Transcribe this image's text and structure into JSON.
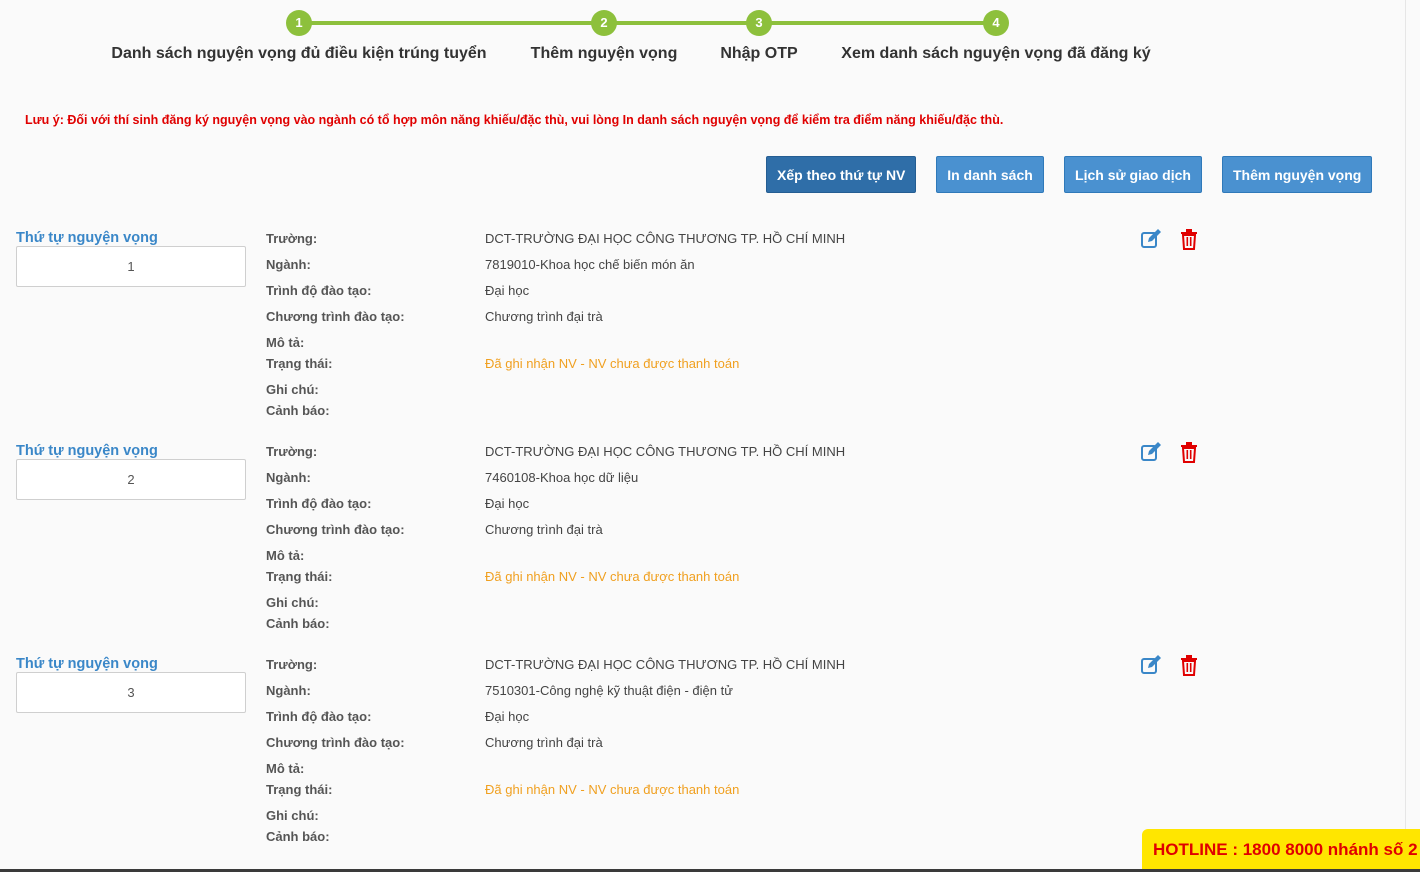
{
  "stepper": {
    "steps": [
      {
        "number": "1",
        "label": "Danh sách nguyện vọng đủ điều kiện trúng tuyển"
      },
      {
        "number": "2",
        "label": "Thêm nguyện vọng"
      },
      {
        "number": "3",
        "label": "Nhập OTP"
      },
      {
        "number": "4",
        "label": "Xem danh sách nguyện vọng đã đăng ký"
      }
    ]
  },
  "notice": "Lưu ý: Đối với thí sinh đăng ký nguyện vọng vào ngành có tổ hợp môn năng khiếu/đặc thù, vui lòng In danh sách nguyện vọng để kiểm tra điểm năng khiếu/đặc thù.",
  "actions": {
    "sort": "Xếp theo thứ tự NV",
    "print": "In danh sách",
    "history": "Lịch sử giao dịch",
    "add": "Thêm nguyện vọng"
  },
  "field_labels": {
    "order": "Thứ tự nguyện vọng",
    "school": "Trường:",
    "major": "Ngành:",
    "level": "Trình độ đào tạo:",
    "program": "Chương trình đào tạo:",
    "description": "Mô tả:",
    "status": "Trạng thái:",
    "note": "Ghi chú:",
    "warning": "Cảnh báo:"
  },
  "wishes": [
    {
      "order": "1",
      "school": "DCT-TRƯỜNG ĐẠI HỌC CÔNG THƯƠNG TP. HỒ CHÍ MINH",
      "major": "7819010-Khoa học chế biến món ăn",
      "level": "Đại học",
      "program": "Chương trình đại trà",
      "description": "",
      "status": "Đã ghi nhận NV - NV chưa được thanh toán",
      "note": "",
      "warning": ""
    },
    {
      "order": "2",
      "school": "DCT-TRƯỜNG ĐẠI HỌC CÔNG THƯƠNG TP. HỒ CHÍ MINH",
      "major": "7460108-Khoa học dữ liệu",
      "level": "Đại học",
      "program": "Chương trình đại trà",
      "description": "",
      "status": "Đã ghi nhận NV - NV chưa được thanh toán",
      "note": "",
      "warning": ""
    },
    {
      "order": "3",
      "school": "DCT-TRƯỜNG ĐẠI HỌC CÔNG THƯƠNG TP. HỒ CHÍ MINH",
      "major": "7510301-Công nghệ kỹ thuật điện - điện tử",
      "level": "Đại học",
      "program": "Chương trình đại trà",
      "description": "",
      "status": "Đã ghi nhận NV - NV chưa được thanh toán",
      "note": "",
      "warning": ""
    }
  ],
  "hotline": "HOTLINE : 1800 8000 nhánh số 2",
  "colors": {
    "step_green": "#8dc03c",
    "button_blue": "#4a91d0",
    "notice_red": "#e00000",
    "status_orange": "#f0a020",
    "hotline_yellow": "#ffe600"
  },
  "icons": {
    "edit": "edit-icon",
    "delete": "trash-icon"
  }
}
